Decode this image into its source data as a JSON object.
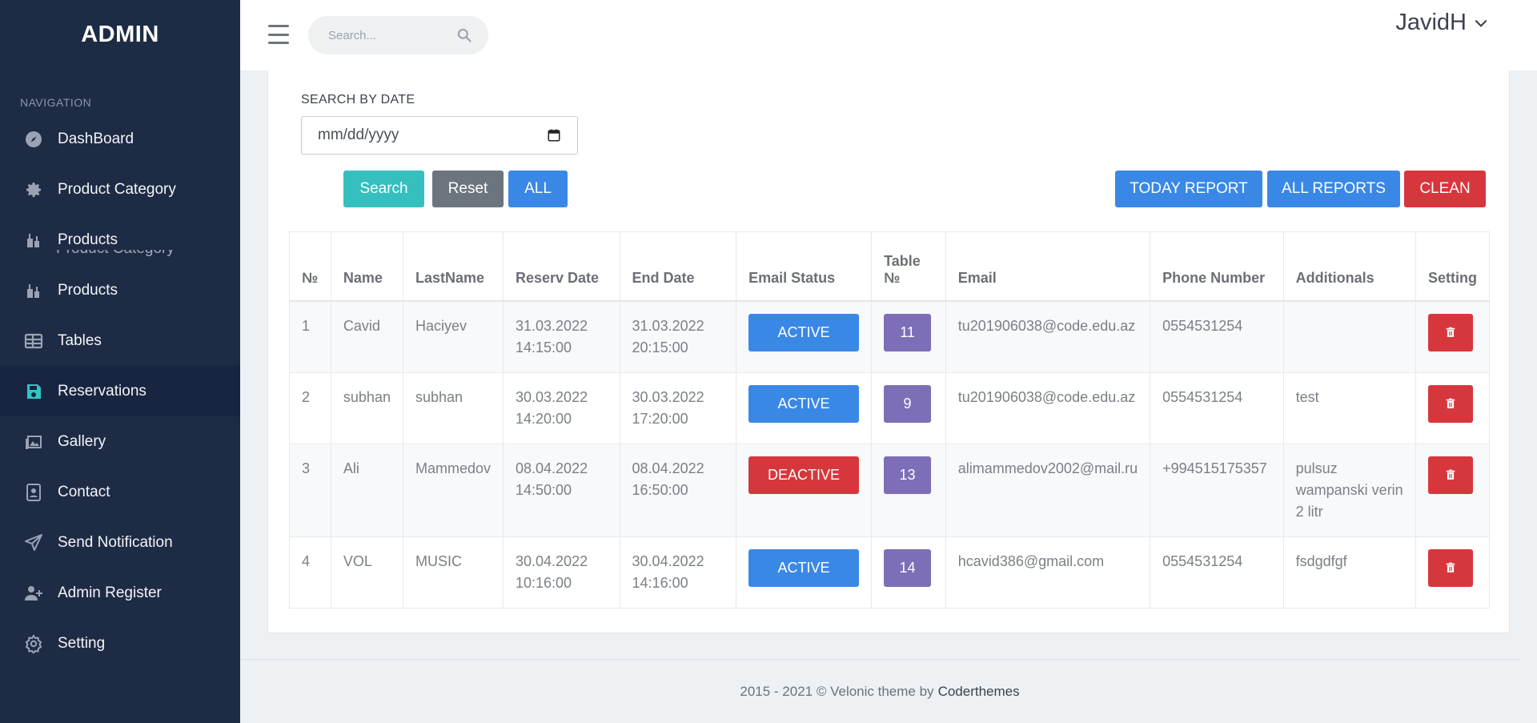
{
  "sidebar": {
    "brand": "ADMIN",
    "heading": "NAVIGATION",
    "ghost_label": "Product Category",
    "items": [
      {
        "label": "DashBoard",
        "icon": "compass-icon"
      },
      {
        "label": "Product Category",
        "icon": "gear-icon"
      },
      {
        "label": "Products",
        "icon": "drink-icon"
      },
      {
        "label": "Products",
        "icon": "drink-icon"
      },
      {
        "label": "Tables",
        "icon": "table-icon"
      },
      {
        "label": "Reservations",
        "icon": "floppy-icon",
        "active": true
      },
      {
        "label": "Gallery",
        "icon": "image-icon"
      },
      {
        "label": "Contact",
        "icon": "contact-icon"
      },
      {
        "label": "Send Notification",
        "icon": "send-icon"
      },
      {
        "label": "Admin Register",
        "icon": "user-plus-icon"
      },
      {
        "label": "Setting",
        "icon": "settings-icon"
      }
    ]
  },
  "topbar": {
    "search_placeholder": "Search...",
    "user_name": "JavidH"
  },
  "filter": {
    "label": "SEARCH BY DATE",
    "date_placeholder": "mm/dd/yyyy",
    "search_btn": "Search",
    "reset_btn": "Reset",
    "all_btn": "ALL",
    "today_report_btn": "TODAY REPORT",
    "all_reports_btn": "ALL REPORTS",
    "clean_btn": "CLEAN"
  },
  "table": {
    "headers": [
      "№",
      "Name",
      "LastName",
      "Reserv Date",
      "End Date",
      "Email Status",
      "Table №",
      "Email",
      "Phone Number",
      "Additionals",
      "Setting"
    ],
    "rows": [
      {
        "no": "1",
        "name": "Cavid",
        "lastname": "Haciyev",
        "reserv_date": "31.03.2022",
        "reserv_time": "14:15:00",
        "end_date": "31.03.2022",
        "end_time": "20:15:00",
        "status": "ACTIVE",
        "table_no": "11",
        "email": "tu201906038@code.edu.az",
        "phone": "0554531254",
        "additionals": ""
      },
      {
        "no": "2",
        "name": "subhan",
        "lastname": "subhan",
        "reserv_date": "30.03.2022",
        "reserv_time": "14:20:00",
        "end_date": "30.03.2022",
        "end_time": "17:20:00",
        "status": "ACTIVE",
        "table_no": "9",
        "email": "tu201906038@code.edu.az",
        "phone": "0554531254",
        "additionals": "test"
      },
      {
        "no": "3",
        "name": "Ali",
        "lastname": "Mammedov",
        "reserv_date": "08.04.2022",
        "reserv_time": "14:50:00",
        "end_date": "08.04.2022",
        "end_time": "16:50:00",
        "status": "DEACTIVE",
        "table_no": "13",
        "email": "alimammedov2002@mail.ru",
        "phone": "+994515175357",
        "additionals": "pulsuz wampanski verin 2 litr"
      },
      {
        "no": "4",
        "name": "VOL",
        "lastname": "MUSIC",
        "reserv_date": "30.04.2022",
        "reserv_time": "10:16:00",
        "end_date": "30.04.2022",
        "end_time": "14:16:00",
        "status": "ACTIVE",
        "table_no": "14",
        "email": "hcavid386@gmail.com",
        "phone": "0554531254",
        "additionals": "fsdgdfgf"
      }
    ]
  },
  "footer": {
    "text": "2015 - 2021 © Velonic theme by",
    "link": "Coderthemes"
  },
  "colors": {
    "sidebar_bg": "#1d2b45",
    "accent_teal": "#36bfbf",
    "primary_blue": "#3a88e6",
    "danger_red": "#d6373c",
    "badge_purple": "#7d6eb7"
  }
}
